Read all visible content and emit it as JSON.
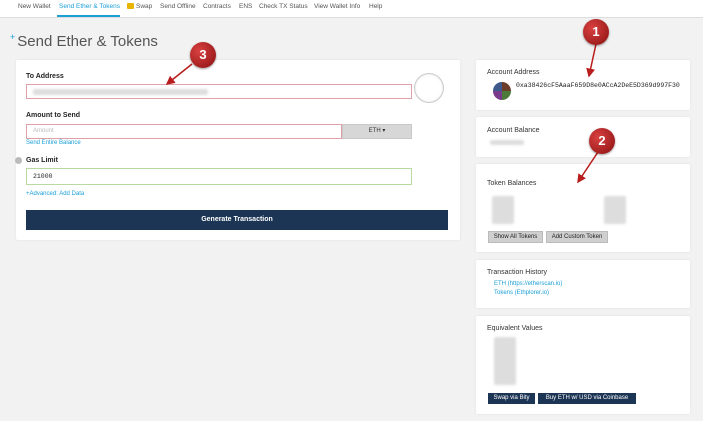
{
  "nav": {
    "items": [
      "New Wallet",
      "Send Ether & Tokens",
      "Swap",
      "Send Offline",
      "Contracts",
      "ENS",
      "Check TX Status",
      "View Wallet Info",
      "Help"
    ]
  },
  "page": {
    "title": "Send Ether & Tokens"
  },
  "form": {
    "to_address_label": "To Address",
    "amount_label": "Amount to Send",
    "amount_placeholder": "Amount",
    "currency": "ETH",
    "send_entire_balance": "Send Entire Balance",
    "gas_limit_label": "Gas Limit",
    "gas_limit_value": "21000",
    "advanced_link": "+Advanced: Add Data",
    "generate_button": "Generate Transaction"
  },
  "sidebar": {
    "account_address_title": "Account Address",
    "account_address": "0xa38426cF5AaaF659D8e0ACcA2DeE5D369d997F30",
    "account_balance_title": "Account Balance",
    "token_balances_title": "Token Balances",
    "show_all_tokens": "Show All Tokens",
    "add_custom_token": "Add Custom Token",
    "tx_history_title": "Transaction History",
    "tx_links": [
      "ETH (https://etherscan.io)",
      "Tokens (Ethplorer.io)"
    ],
    "equivalent_values_title": "Equivalent Values",
    "swap_button": "Swap via Bity",
    "buy_button": "Buy ETH w/ USD via Coinbase"
  },
  "markers": [
    "1",
    "2",
    "3"
  ],
  "colors": {
    "accent": "#1a9fd6",
    "button_dark": "#1c3554",
    "marker_red": "#b81c1c"
  }
}
